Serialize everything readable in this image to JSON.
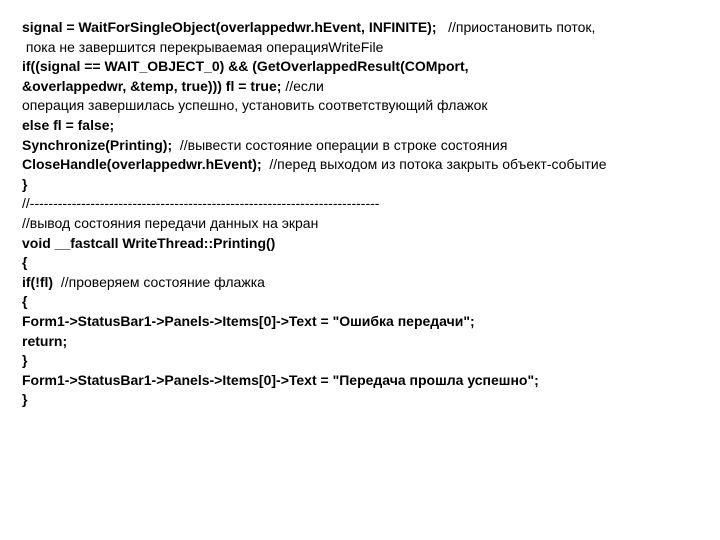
{
  "lines": [
    {
      "segments": [
        {
          "text": "signal = WaitForSingleObject(overlappedwr.hEvent, INFINITE);",
          "bold": true
        },
        {
          "text": "   //приостановить поток,",
          "bold": false
        }
      ]
    },
    {
      "segments": [
        {
          "text": " пока не завершится перекрываемая операцияWriteFile",
          "bold": false
        }
      ]
    },
    {
      "segments": [
        {
          "text": "if((signal == WAIT_OBJECT_0) && (GetOverlappedResult(COMport,",
          "bold": true
        }
      ]
    },
    {
      "segments": [
        {
          "text": "&overlappedwr, &temp, true))) fl = true;",
          "bold": true
        },
        {
          "text": " //если",
          "bold": false
        }
      ]
    },
    {
      "segments": [
        {
          "text": "операция завершилась успешно, установить соответствующий флажок",
          "bold": false
        }
      ]
    },
    {
      "segments": [
        {
          "text": "else fl = false;",
          "bold": true
        }
      ]
    },
    {
      "segments": [
        {
          "text": "Synchronize(Printing);",
          "bold": true
        },
        {
          "text": "  //вывести состояние операции в строке состояния",
          "bold": false
        }
      ]
    },
    {
      "segments": [
        {
          "text": "CloseHandle(overlappedwr.hEvent);",
          "bold": true
        },
        {
          "text": "  //перед выходом из потока закрыть объект-событие",
          "bold": false
        }
      ]
    },
    {
      "segments": [
        {
          "text": "}",
          "bold": true
        }
      ]
    },
    {
      "segments": [
        {
          "text": "//---------------------------------------------------------------------------",
          "bold": false
        }
      ]
    },
    {
      "segments": [
        {
          "text": "//вывод состояния передачи данных на экран",
          "bold": false
        }
      ]
    },
    {
      "segments": [
        {
          "text": "void __fastcall WriteThread::Printing()",
          "bold": true
        }
      ]
    },
    {
      "segments": [
        {
          "text": "{",
          "bold": true
        }
      ]
    },
    {
      "segments": [
        {
          "text": "if(!fl)",
          "bold": true
        },
        {
          "text": "  //проверяем состояние флажка",
          "bold": false
        }
      ]
    },
    {
      "segments": [
        {
          "text": "{",
          "bold": true
        }
      ]
    },
    {
      "segments": [
        {
          "text": "Form1->StatusBar1->Panels->Items[0]->Text = \"Ошибка передачи\";",
          "bold": true
        }
      ]
    },
    {
      "segments": [
        {
          "text": "return;",
          "bold": true
        }
      ]
    },
    {
      "segments": [
        {
          "text": "}",
          "bold": true
        }
      ]
    },
    {
      "segments": [
        {
          "text": "Form1->StatusBar1->Panels->Items[0]->Text = \"Передача прошла успешно\";",
          "bold": true
        }
      ]
    },
    {
      "segments": [
        {
          "text": "}",
          "bold": true
        }
      ]
    }
  ]
}
